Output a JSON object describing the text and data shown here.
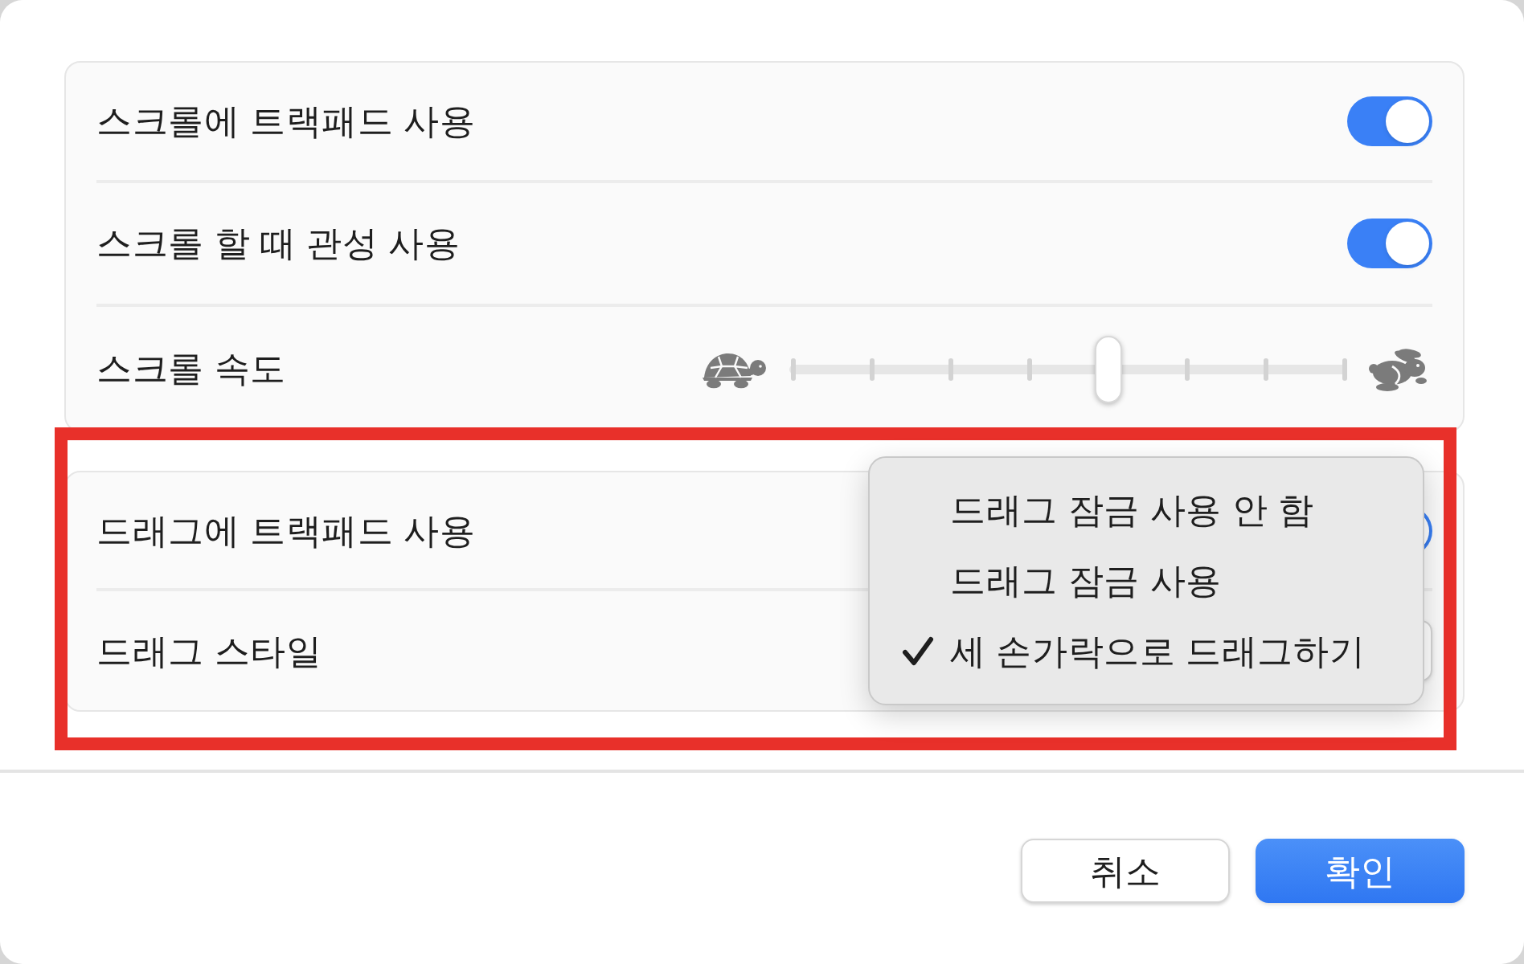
{
  "scroll_panel": {
    "rows": [
      {
        "kind": "toggle",
        "label": "스크롤에 트랙패드 사용",
        "on": true
      },
      {
        "kind": "toggle",
        "label": "스크롤 할 때 관성 사용",
        "on": true
      },
      {
        "kind": "slider",
        "label": "스크롤 속도",
        "level": 0.571
      }
    ]
  },
  "drag_panel": {
    "rows": [
      {
        "kind": "toggle",
        "label": "드래그에 트랙패드 사용",
        "on": true
      },
      {
        "kind": "dropdown",
        "label": "드래그 스타일"
      }
    ]
  },
  "dropdown_menu": {
    "items": [
      {
        "label": "드래그 잠금 사용 안 함",
        "selected": false
      },
      {
        "label": "드래그 잠금 사용",
        "selected": false
      },
      {
        "label": "세 손가락으로 드래그하기",
        "selected": true
      }
    ]
  },
  "buttons": [
    {
      "label": "취소",
      "kind": "secondary"
    },
    {
      "label": "확인",
      "kind": "primary"
    }
  ]
}
